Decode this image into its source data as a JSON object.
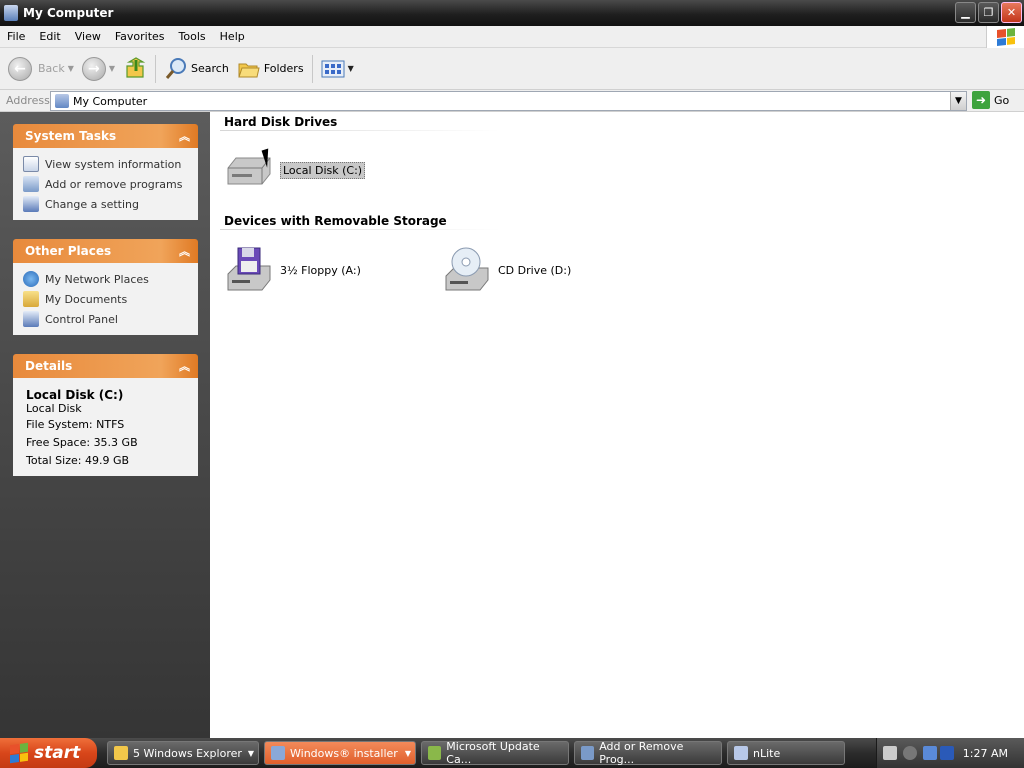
{
  "window": {
    "title": "My Computer"
  },
  "menu": [
    "File",
    "Edit",
    "View",
    "Favorites",
    "Tools",
    "Help"
  ],
  "toolbar": {
    "back": "Back",
    "search": "Search",
    "folders": "Folders"
  },
  "address": {
    "label": "Address",
    "value": "My Computer",
    "go": "Go"
  },
  "sidebar": {
    "system_tasks": {
      "title": "System Tasks",
      "items": [
        "View system information",
        "Add or remove programs",
        "Change a setting"
      ]
    },
    "other_places": {
      "title": "Other Places",
      "items": [
        "My Network Places",
        "My Documents",
        "Control Panel"
      ]
    },
    "details": {
      "title": "Details",
      "name": "Local Disk (C:)",
      "type": "Local Disk",
      "file_system": "File System: NTFS",
      "free_space": "Free Space: 35.3 GB",
      "total_size": "Total Size: 49.9 GB"
    }
  },
  "content": {
    "hard_disk_header": "Hard Disk Drives",
    "local_disk": "Local Disk (C:)",
    "removable_header": "Devices with Removable Storage",
    "floppy": "3½ Floppy (A:)",
    "cd": "CD Drive (D:)"
  },
  "taskbar": {
    "start": "start",
    "tasks": [
      "5 Windows Explorer",
      "Windows® installer",
      "Microsoft Update Ca...",
      "Add or Remove Prog...",
      "nLite"
    ],
    "clock": "1:27 AM"
  },
  "colors": {
    "panel_header": "#e88a3c",
    "sidebar": "#4a4a4a",
    "start": "#d8461a"
  }
}
